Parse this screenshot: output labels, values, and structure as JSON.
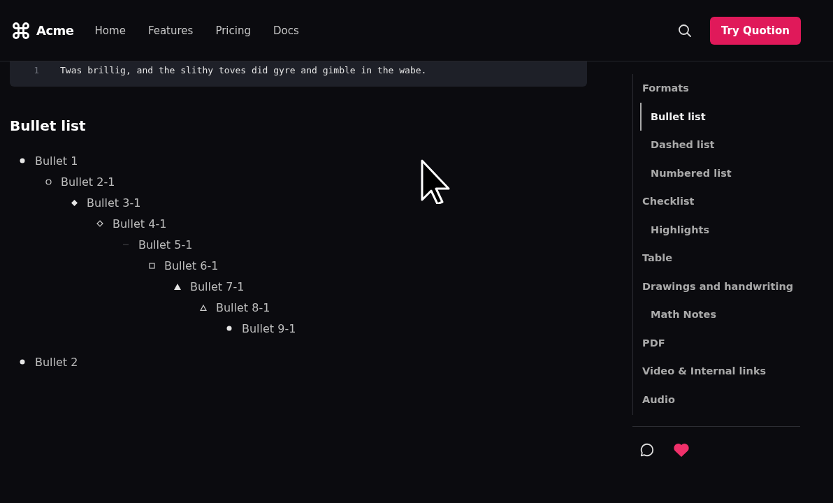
{
  "header": {
    "brand": "Acme",
    "nav": [
      {
        "label": "Home"
      },
      {
        "label": "Features"
      },
      {
        "label": "Pricing"
      },
      {
        "label": "Docs"
      }
    ],
    "cta": "Try Quotion"
  },
  "code_block": {
    "lines": [
      {
        "number": "1",
        "text": "Twas brillig, and the slithy toves did gyre and gimble in the wabe."
      }
    ]
  },
  "section_title": "Bullet list",
  "bullets": [
    {
      "text": "Bullet 1",
      "children": [
        {
          "text": "Bullet 2-1",
          "children": [
            {
              "text": "Bullet 3-1",
              "children": [
                {
                  "text": "Bullet 4-1",
                  "children": [
                    {
                      "text": "Bullet 5-1",
                      "children": [
                        {
                          "text": "Bullet 6-1",
                          "children": [
                            {
                              "text": "Bullet 7-1",
                              "children": [
                                {
                                  "text": "Bullet 8-1",
                                  "children": [
                                    {
                                      "text": "Bullet 9-1"
                                    }
                                  ]
                                }
                              ]
                            }
                          ]
                        }
                      ]
                    }
                  ]
                }
              ]
            }
          ]
        }
      ]
    },
    {
      "text": "Bullet 2"
    }
  ],
  "toc": [
    {
      "label": "Formats",
      "selected": false,
      "children": [
        {
          "label": "Bullet list",
          "selected": true
        },
        {
          "label": "Dashed list",
          "selected": false
        },
        {
          "label": "Numbered list",
          "selected": false
        }
      ]
    },
    {
      "label": "Checklist",
      "selected": false,
      "children": [
        {
          "label": "Highlights",
          "selected": false
        }
      ]
    },
    {
      "label": "Table",
      "selected": false
    },
    {
      "label": "Drawings and handwriting",
      "selected": false,
      "children": [
        {
          "label": "Math Notes",
          "selected": false
        }
      ]
    },
    {
      "label": "PDF",
      "selected": false
    },
    {
      "label": "Video & Internal links",
      "selected": false
    },
    {
      "label": "Audio",
      "selected": false
    }
  ]
}
